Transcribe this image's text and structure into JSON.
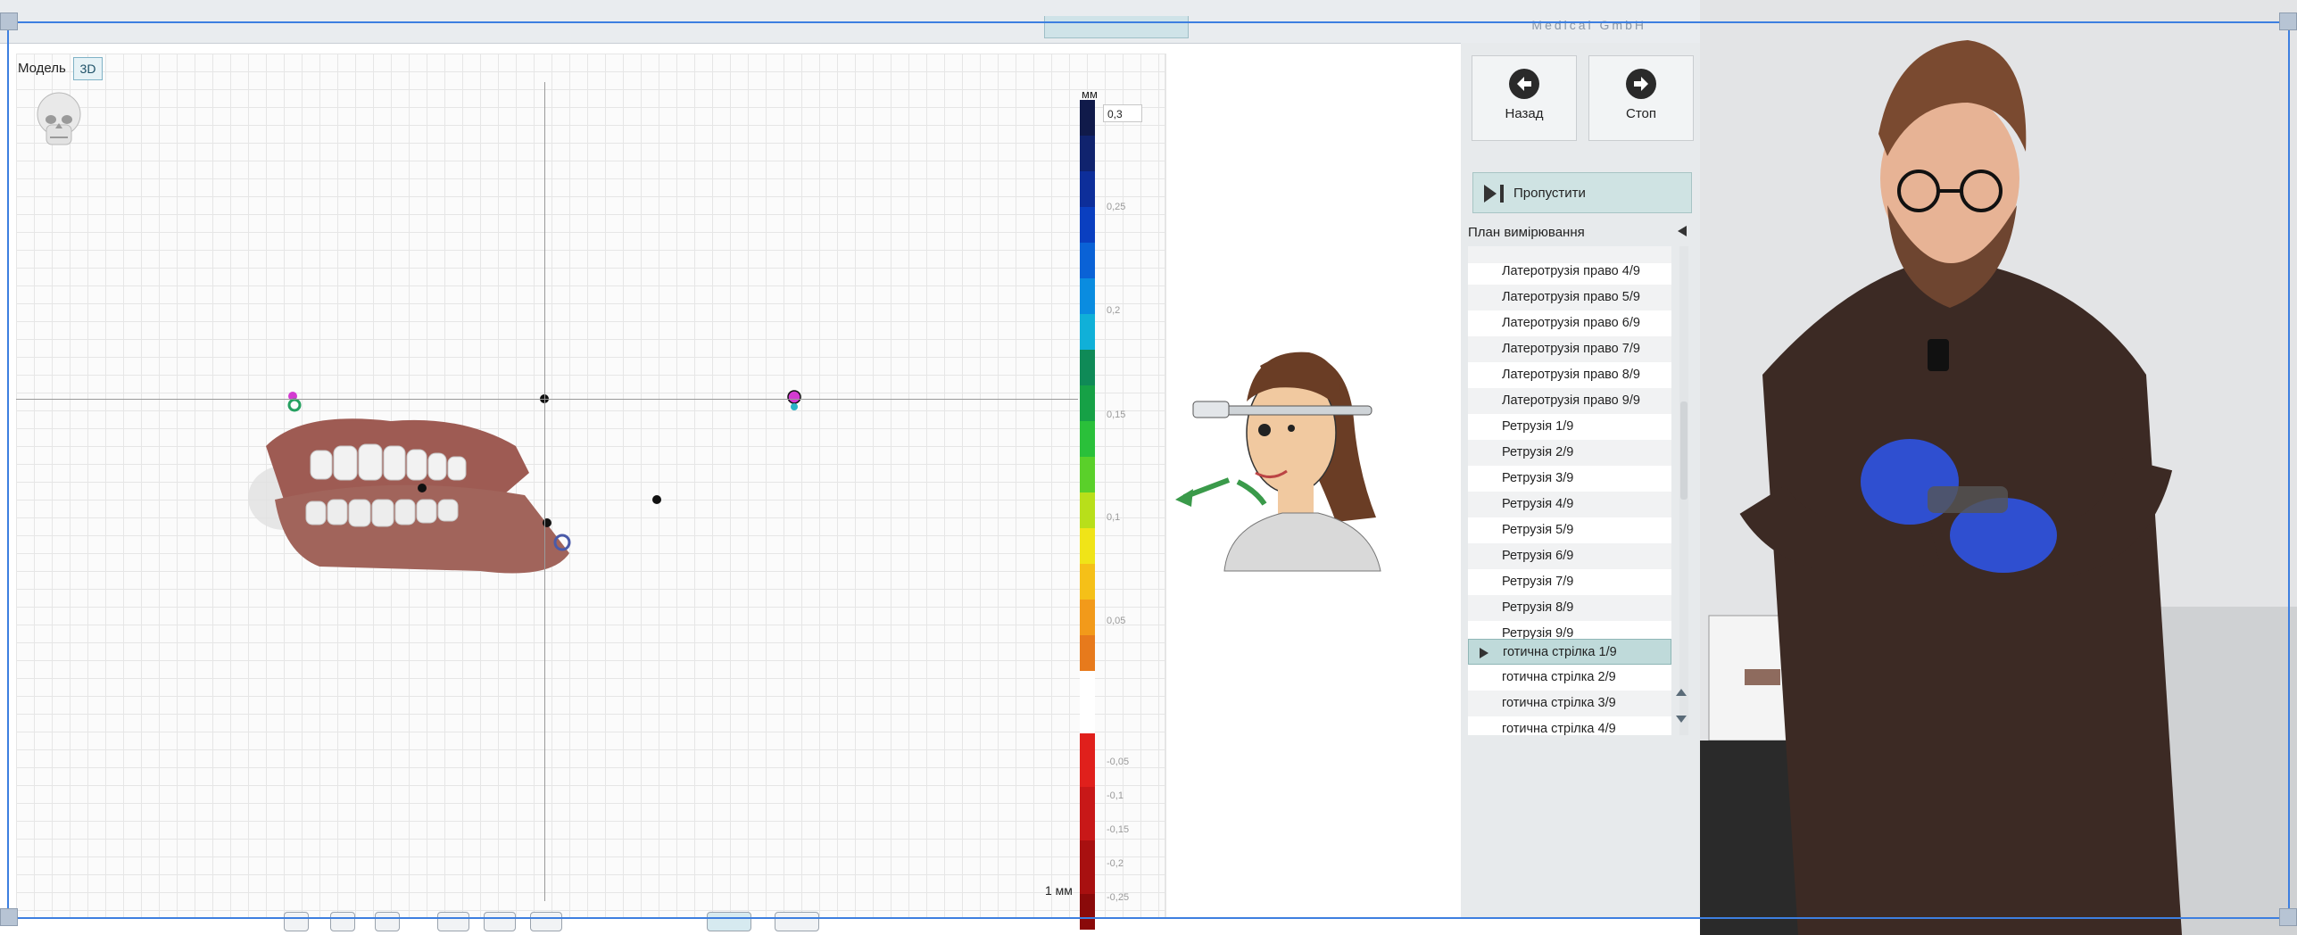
{
  "app": {
    "brand": "Medical GmbH"
  },
  "viewport": {
    "model_label": "Модель",
    "view_button": "3D",
    "unit_label": "мм",
    "max_value": "0,3",
    "scale_label": "1 мм",
    "colorbar_ticks": [
      "0,25",
      "0,2",
      "0,15",
      "0,1",
      "0,05",
      "-0,05",
      "-0,1",
      "-0,15",
      "-0,2",
      "-0,25"
    ]
  },
  "nav": {
    "back_label": "Назад",
    "stop_label": "Стоп",
    "skip_label": "Пропустити"
  },
  "plan": {
    "title": "План вимірювання",
    "items": [
      "Латеротрузія право 4/9",
      "Латеротрузія право 5/9",
      "Латеротрузія право 6/9",
      "Латеротрузія право 7/9",
      "Латеротрузія право 8/9",
      "Латеротрузія право 9/9",
      "Ретрузія 1/9",
      "Ретрузія 2/9",
      "Ретрузія 3/9",
      "Ретрузія 4/9",
      "Ретрузія 5/9",
      "Ретрузія 6/9",
      "Ретрузія 7/9",
      "Ретрузія 8/9",
      "Ретрузія 9/9",
      "готична стрілка 1/9",
      "готична стрілка 2/9",
      "готична стрілка 3/9",
      "готична стрілка 4/9"
    ],
    "selected_index": 15
  },
  "colors": {
    "accent": "#3d7fe0",
    "selected_row": "#bfdada",
    "glove": "#2f4fd0"
  }
}
